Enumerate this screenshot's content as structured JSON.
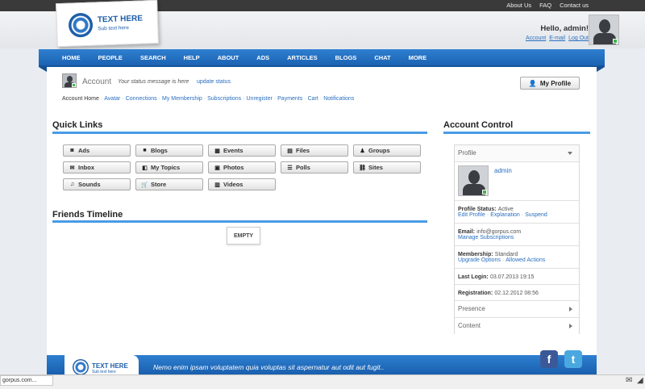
{
  "topbar": {
    "links": [
      "About Us",
      "FAQ",
      "Contact us"
    ]
  },
  "logo": {
    "title": "TEXT HERE",
    "subtitle": "Sub text here"
  },
  "user": {
    "greeting": "Hello, admin!",
    "links": [
      "Account",
      "E-mail",
      "Log Out"
    ]
  },
  "nav": [
    "HOME",
    "PEOPLE",
    "SEARCH",
    "HELP",
    "ABOUT",
    "ADS",
    "ARTICLES",
    "BLOGS",
    "CHAT",
    "MORE"
  ],
  "account_header": {
    "title": "Account",
    "status_text": "Your status message is here",
    "status_link": "update status",
    "my_profile_label": "My Profile"
  },
  "subnav": [
    "Account Home",
    "Avatar",
    "Connections",
    "My Membership",
    "Subscriptions",
    "Unregister",
    "Payments",
    "Cart",
    "Notifications"
  ],
  "quick_links": {
    "title": "Quick Links",
    "items": [
      {
        "label": "Ads",
        "icon": "ads-icon",
        "glyph": "◙"
      },
      {
        "label": "Blogs",
        "icon": "book-icon",
        "glyph": "■"
      },
      {
        "label": "Events",
        "icon": "calendar-icon",
        "glyph": "▦"
      },
      {
        "label": "Files",
        "icon": "file-icon",
        "glyph": "▤"
      },
      {
        "label": "Groups",
        "icon": "group-icon",
        "glyph": "♟"
      },
      {
        "label": "Inbox",
        "icon": "envelope-icon",
        "glyph": "✉"
      },
      {
        "label": "My Topics",
        "icon": "topics-icon",
        "glyph": "◧"
      },
      {
        "label": "Photos",
        "icon": "image-icon",
        "glyph": "▣"
      },
      {
        "label": "Polls",
        "icon": "poll-icon",
        "glyph": "☰"
      },
      {
        "label": "Sites",
        "icon": "link-icon",
        "glyph": "⛓"
      },
      {
        "label": "Sounds",
        "icon": "music-icon",
        "glyph": "♫"
      },
      {
        "label": "Store",
        "icon": "cart-icon",
        "glyph": "🛒"
      },
      {
        "label": "Videos",
        "icon": "film-icon",
        "glyph": "▥"
      }
    ]
  },
  "friends_timeline": {
    "title": "Friends Timeline",
    "empty_label": "EMPTY"
  },
  "account_control": {
    "title": "Account Control",
    "profile_header": "Profile",
    "username": "admin",
    "profile_status_label": "Profile Status:",
    "profile_status_value": "Active",
    "profile_status_links": [
      "Edit Profile",
      "Explanation",
      "Suspend"
    ],
    "email_label": "Email:",
    "email_value": "info@gorpus.com",
    "email_links": [
      "Manage Subscriptions"
    ],
    "membership_label": "Membership:",
    "membership_value": "Standard",
    "membership_links": [
      "Upgrade Options",
      "Allowed Actions"
    ],
    "last_login_label": "Last Login:",
    "last_login_value": "03.07.2013 19:15",
    "registration_label": "Registration:",
    "registration_value": "02.12.2012 08:56",
    "presence_label": "Presence",
    "content_label": "Content"
  },
  "footer": {
    "logo_title": "TEXT HERE",
    "logo_subtitle": "Sub text here",
    "quote": "Nemo enim ipsam voluptatem quia voluptas sit aspernatur aut odit aut fugit.."
  },
  "statusbar": {
    "url": "gorpus.com..."
  },
  "colors": {
    "brand_blue": "#1c63b3",
    "accent_blue": "#4a9be6",
    "topbar": "#3a3a3a",
    "online": "#3bb54a"
  }
}
